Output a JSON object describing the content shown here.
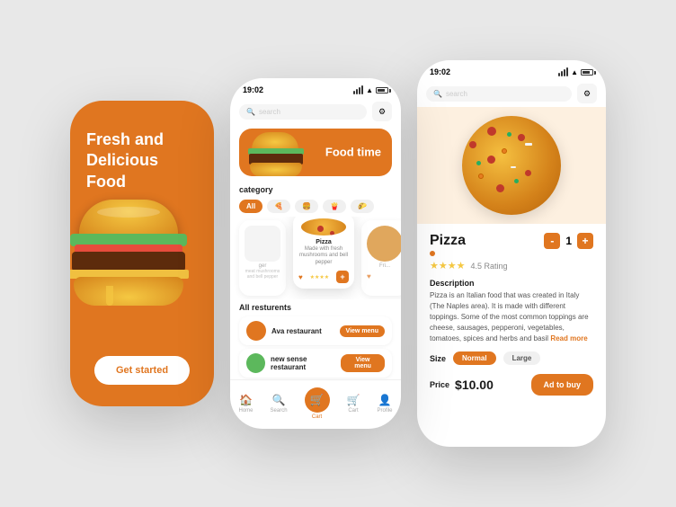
{
  "background": "#e8e8e8",
  "phone1": {
    "headline": "Fresh and\nDelicious\nFood",
    "cta": "Get started",
    "bg_color": "#e07620"
  },
  "phone2": {
    "status_time": "19:02",
    "search_placeholder": "search",
    "hero_text": "Food time",
    "category_title": "category",
    "categories": [
      {
        "label": "All",
        "active": true
      },
      {
        "label": "🍕 Pizza",
        "active": false
      },
      {
        "label": "🍔 Burger",
        "active": false
      },
      {
        "label": "🍟 Fries",
        "active": false
      },
      {
        "label": "🌮 Wrap",
        "active": false
      }
    ],
    "featured_food": {
      "name": "Pizza",
      "desc": "Made with fresh mushrooms and bell pepper",
      "rating": "4.0"
    },
    "all_restaurants_label": "All resturents",
    "restaurants": [
      {
        "name": "Ava restaurant",
        "cta": "View menu"
      },
      {
        "name": "new sense restaurant",
        "cta": "View menu"
      }
    ],
    "nav_items": [
      {
        "label": "Home",
        "icon": "🏠",
        "active": false
      },
      {
        "label": "Search",
        "icon": "🔍",
        "active": false
      },
      {
        "label": "Cart",
        "icon": "🛒",
        "active": true
      },
      {
        "label": "Cart",
        "icon": "🛒",
        "active": false
      },
      {
        "label": "Profile",
        "icon": "👤",
        "active": false
      }
    ]
  },
  "phone3": {
    "status_time": "19:02",
    "search_placeholder": "search",
    "food_name": "Pizza",
    "rating_stars": "★★★★",
    "rating_value": "4.5 Rating",
    "quantity": "1",
    "description_label": "Description",
    "description": "Pizza is an Italian food that was created in Italy (The Naples area). It is made with different toppings. Some of the most common toppings are cheese, sausages, pepperoni, vegetables, tomatoes, spices and herbs and basil",
    "read_more": "Read more",
    "size_label": "Size",
    "sizes": [
      {
        "label": "Normal",
        "active": true
      },
      {
        "label": "Large",
        "active": false
      }
    ],
    "price_label": "Price",
    "price": "$10.00",
    "cta": "Ad to buy"
  }
}
